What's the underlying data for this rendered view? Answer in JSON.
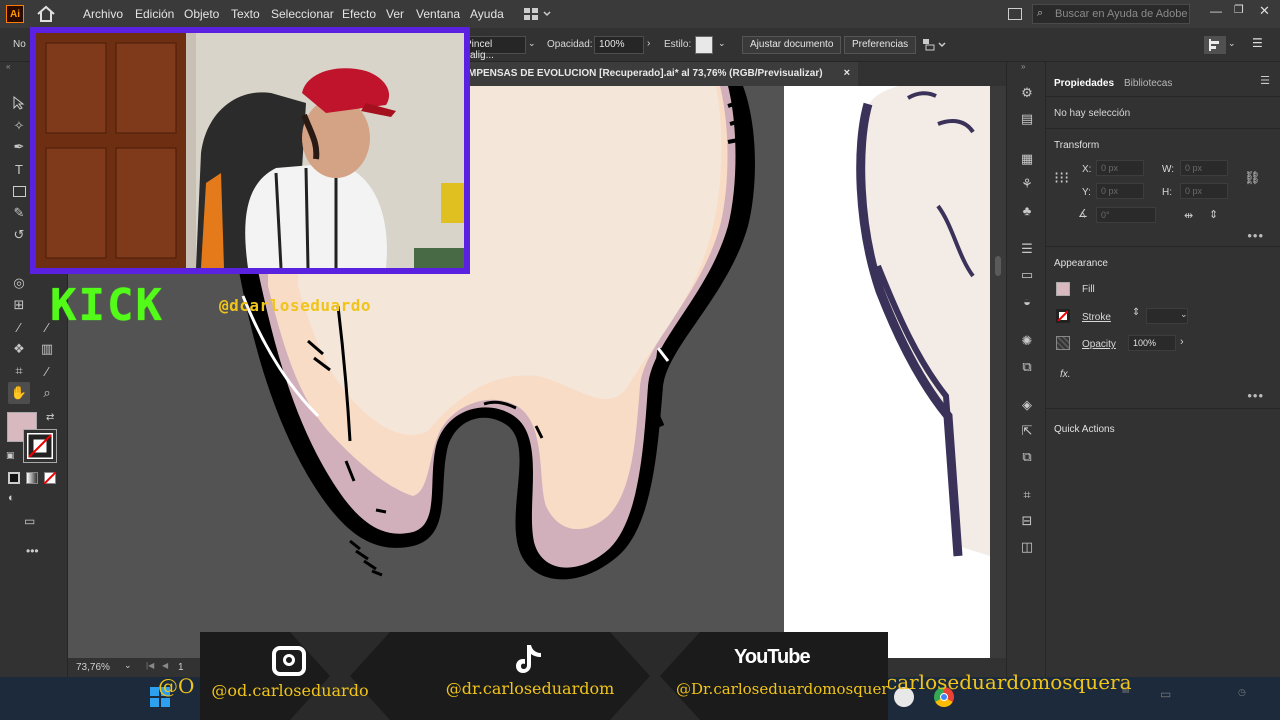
{
  "app": {
    "logo": "Ai",
    "menu": [
      "Archivo",
      "Edición",
      "Objeto",
      "Texto",
      "Seleccionar",
      "Efecto",
      "Ver",
      "Ventana",
      "Ayuda"
    ],
    "search_placeholder": "Buscar en Ayuda de Adobe"
  },
  "controlbar": {
    "no_selection_short": "No",
    "brush": "Pincel calig...",
    "opacity_label": "Opacidad:",
    "opacity_value": "100%",
    "style_label": "Estilo:",
    "adjust_document": "Ajustar documento",
    "preferences": "Preferencias"
  },
  "document": {
    "tab_title": "MPENSAS DE EVOLUCION [Recuperado].ai* al 73,76% (RGB/Previsualizar)",
    "close": "×",
    "zoom": "73,76%",
    "artboard": "1"
  },
  "panel": {
    "tabs": [
      "Propiedades",
      "Bibliotecas"
    ],
    "no_selection": "No hay selección",
    "transform": {
      "title": "Transform",
      "x_label": "X:",
      "y_label": "Y:",
      "w_label": "W:",
      "h_label": "H:",
      "x": "0 px",
      "y": "0 px",
      "w": "0 px",
      "h": "0 px",
      "angle": "0°"
    },
    "appearance": {
      "title": "Appearance",
      "fill": "Fill",
      "stroke": "Stroke",
      "opacity": "Opacity",
      "opacity_value": "100%",
      "fx": "fx."
    },
    "quick_actions": "Quick Actions"
  },
  "overlay": {
    "kick": "KICK",
    "kick_handle": "@dcarloseduardo",
    "instagram": "@od.carloseduardo",
    "tiktok": "@dr.carloseduardom",
    "youtube_logo": "YouTube",
    "youtube": "@Dr.carloseduardomosquera",
    "taskbar_left": "@O",
    "taskbar_right": "carloseduardomosquera"
  },
  "colors": {
    "fill_swatch": "#d9b9c0",
    "tooth_light": "#f5e6da",
    "tooth_peach": "#f8dcc6",
    "tooth_pink": "#d1b0bb",
    "kick_green": "#53fc18",
    "handle_yellow": "#f0c419",
    "webcam_border": "#5a22e0"
  }
}
